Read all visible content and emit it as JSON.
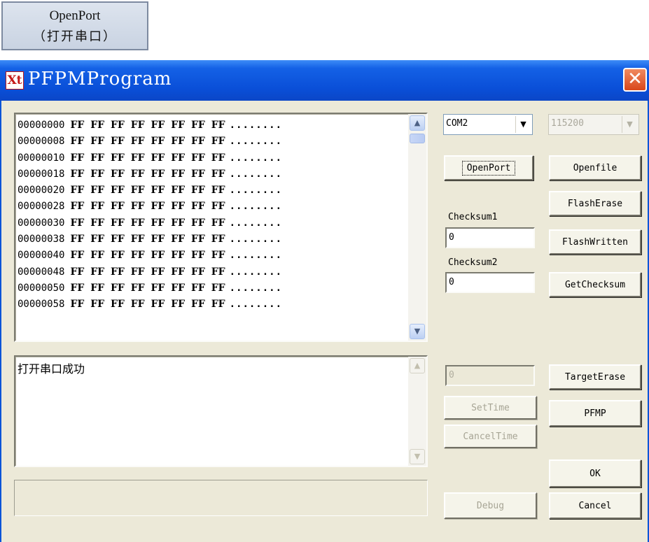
{
  "callout": {
    "line1": "OpenPort",
    "line2": "（打开串口）"
  },
  "window": {
    "icon_text": "Xt",
    "title": "PFPMProgram",
    "close_glyph": "✕"
  },
  "hexview": {
    "lines": [
      {
        "addr": "00000000",
        "bytes": "FF FF FF FF FF FF FF FF",
        "ascii": "........"
      },
      {
        "addr": "00000008",
        "bytes": "FF FF FF FF FF FF FF FF",
        "ascii": "........"
      },
      {
        "addr": "00000010",
        "bytes": "FF FF FF FF FF FF FF FF",
        "ascii": "........"
      },
      {
        "addr": "00000018",
        "bytes": "FF FF FF FF FF FF FF FF",
        "ascii": "........"
      },
      {
        "addr": "00000020",
        "bytes": "FF FF FF FF FF FF FF FF",
        "ascii": "........"
      },
      {
        "addr": "00000028",
        "bytes": "FF FF FF FF FF FF FF FF",
        "ascii": "........"
      },
      {
        "addr": "00000030",
        "bytes": "FF FF FF FF FF FF FF FF",
        "ascii": "........"
      },
      {
        "addr": "00000038",
        "bytes": "FF FF FF FF FF FF FF FF",
        "ascii": "........"
      },
      {
        "addr": "00000040",
        "bytes": "FF FF FF FF FF FF FF FF",
        "ascii": "........"
      },
      {
        "addr": "00000048",
        "bytes": "FF FF FF FF FF FF FF FF",
        "ascii": "........"
      },
      {
        "addr": "00000050",
        "bytes": "FF FF FF FF FF FF FF FF",
        "ascii": "........"
      },
      {
        "addr": "00000058",
        "bytes": "FF FF FF FF FF FF FF FF",
        "ascii": "........"
      }
    ]
  },
  "log": {
    "text": "打开串口成功"
  },
  "port": {
    "selected": "COM2"
  },
  "baud": {
    "selected": "115200"
  },
  "buttons": {
    "open_port": "OpenPort",
    "open_file": "Openfile",
    "flash_erase": "FlashErase",
    "flash_written": "FlashWritten",
    "get_checksum": "GetChecksum",
    "target_erase": "TargetErase",
    "set_time": "SetTime",
    "pfmp": "PFMP",
    "cancel_time": "CancelTime",
    "ok": "OK",
    "debug": "Debug",
    "cancel": "Cancel"
  },
  "checksum1": {
    "label": "Checksum1",
    "value": "0"
  },
  "checksum2": {
    "label": "Checksum2",
    "value": "0"
  },
  "time_field": {
    "value": "0"
  },
  "icons": {
    "scroll_up": "▲",
    "scroll_down": "▼",
    "dropdown": "▼"
  }
}
